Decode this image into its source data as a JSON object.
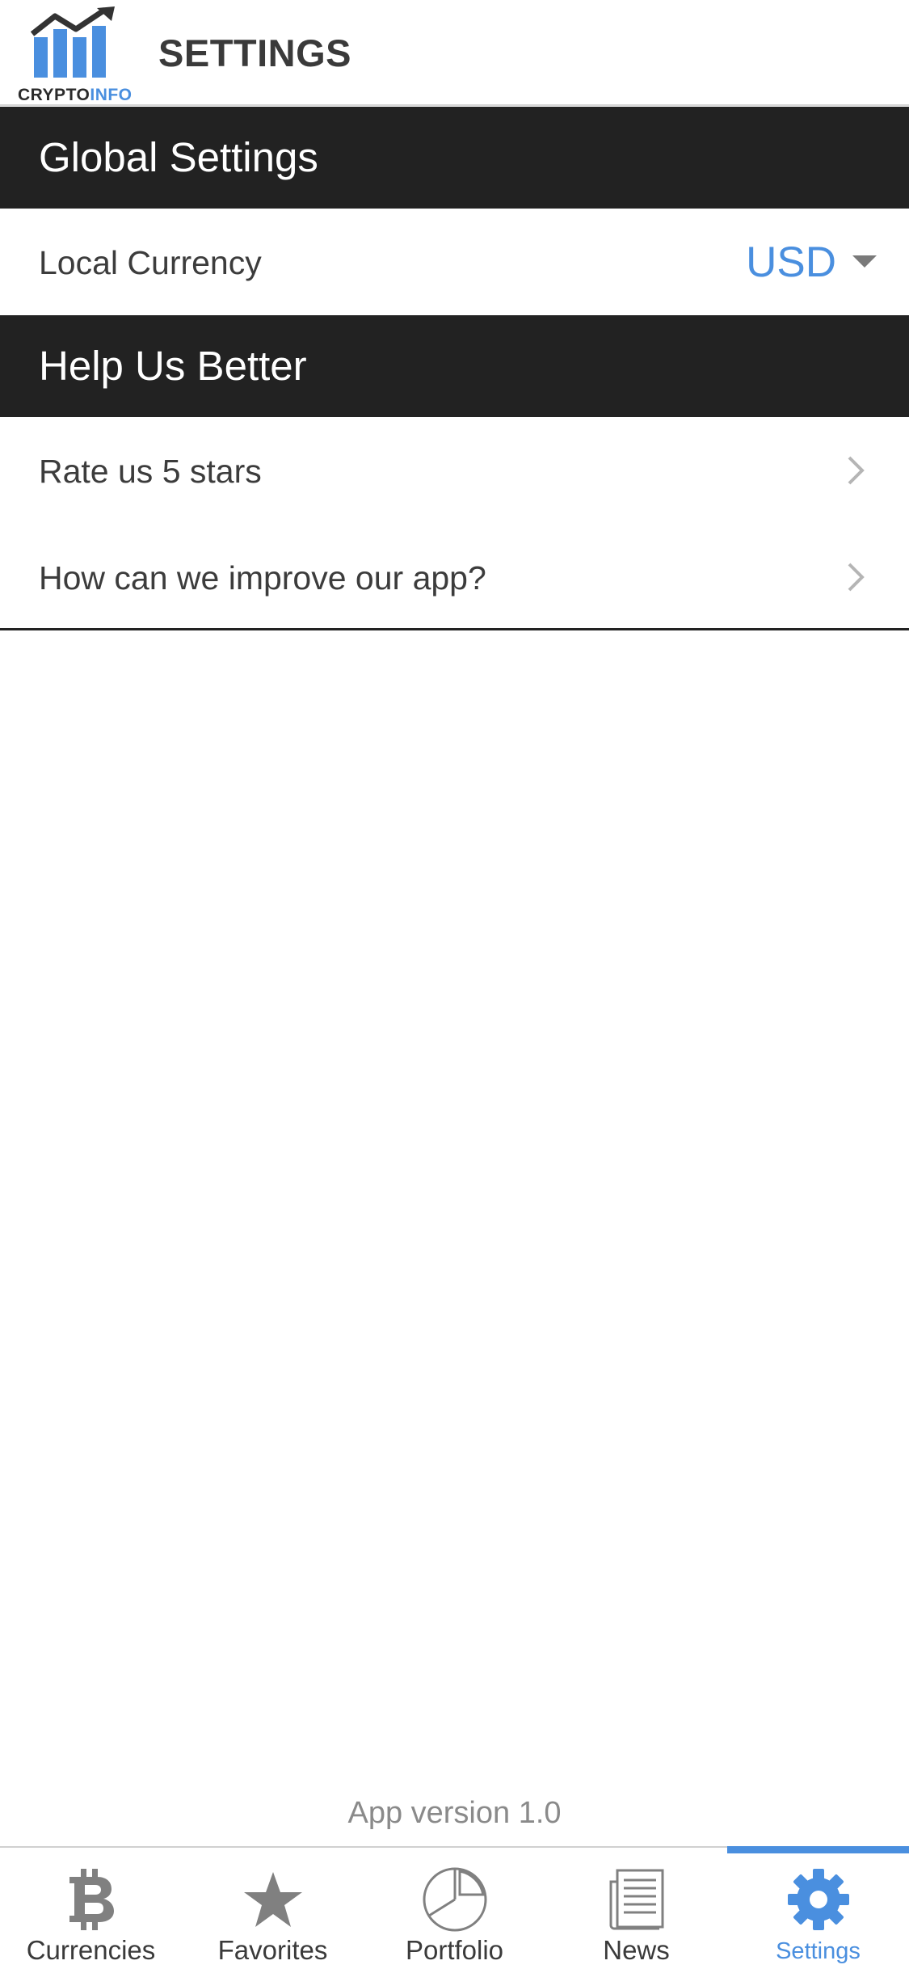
{
  "header": {
    "logo_word_1": "CRYPTO",
    "logo_word_2": "INFO",
    "title": "SETTINGS"
  },
  "sections": {
    "global": {
      "title": "Global Settings"
    },
    "help": {
      "title": "Help Us Better"
    }
  },
  "local_currency": {
    "label": "Local Currency",
    "value": "USD"
  },
  "help_items": {
    "rate": "Rate us 5 stars",
    "improve": "How can we improve our app?"
  },
  "app_version": "App version 1.0",
  "tabs": {
    "currencies": {
      "label": "Currencies",
      "icon": "bitcoin-icon"
    },
    "favorites": {
      "label": "Favorites",
      "icon": "star-icon"
    },
    "portfolio": {
      "label": "Portfolio",
      "icon": "pie-chart-icon"
    },
    "news": {
      "label": "News",
      "icon": "newspaper-icon"
    },
    "settings": {
      "label": "Settings",
      "icon": "gear-icon",
      "active": true
    }
  },
  "colors": {
    "accent": "#4a8fdf",
    "section_header_bg": "#222222",
    "tab_icon_inactive": "#808080"
  }
}
